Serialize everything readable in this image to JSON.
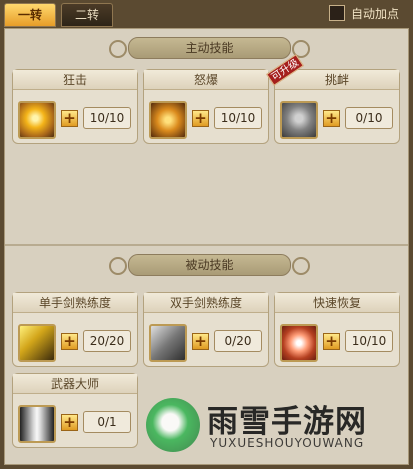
{
  "tabs": {
    "first": "一转",
    "second": "二转"
  },
  "auto_add": "自动加点",
  "sections": {
    "active": "主动技能",
    "passive": "被动技能"
  },
  "skills": {
    "active": [
      {
        "name": "狂击",
        "level": "10/10",
        "icon": "flame-slash-icon"
      },
      {
        "name": "怒爆",
        "level": "10/10",
        "icon": "burst-icon"
      },
      {
        "name": "挑衅",
        "level": "0/10",
        "icon": "stone-warrior-icon",
        "badge": "可升级"
      }
    ],
    "passive": [
      {
        "name": "单手剑熟练度",
        "level": "20/20",
        "icon": "one-hand-sword-icon"
      },
      {
        "name": "双手剑熟练度",
        "level": "0/20",
        "icon": "two-hand-sword-icon"
      },
      {
        "name": "快速恢复",
        "level": "10/10",
        "icon": "recovery-icon"
      },
      {
        "name": "武器大师",
        "level": "0/1",
        "icon": "weapon-master-icon"
      }
    ]
  },
  "watermark": {
    "cn": "雨雪手游网",
    "en": "YUXUESHOUYOUWANG"
  }
}
